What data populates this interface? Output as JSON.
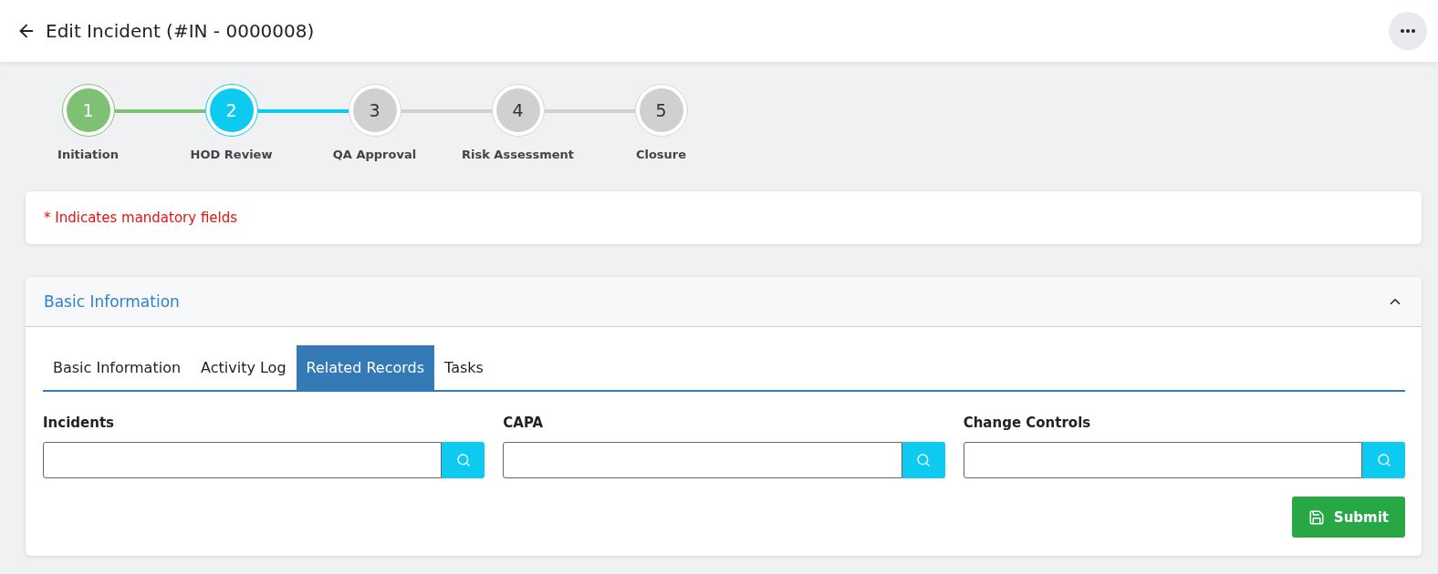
{
  "header": {
    "title": "Edit Incident (#IN - 0000008)"
  },
  "steps": [
    {
      "number": "1",
      "label": "Initiation",
      "completed": true,
      "selected": false
    },
    {
      "number": "2",
      "label": "HOD Review",
      "completed": false,
      "selected": true
    },
    {
      "number": "3",
      "label": "QA Approval",
      "completed": false,
      "selected": false
    },
    {
      "number": "4",
      "label": "Risk Assessment",
      "completed": false,
      "selected": false
    },
    {
      "number": "5",
      "label": "Closure",
      "completed": false,
      "selected": false
    }
  ],
  "notice": "* Indicates mandatory fields",
  "section": {
    "title": "Basic Information",
    "expanded": true,
    "tabs": [
      {
        "label": "Basic Information",
        "selected": false
      },
      {
        "label": "Activity Log",
        "selected": false
      },
      {
        "label": "Related Records",
        "selected": true
      },
      {
        "label": "Tasks",
        "selected": false
      }
    ],
    "fields": [
      {
        "label": "Incidents"
      },
      {
        "label": "CAPA"
      },
      {
        "label": "Change Controls"
      }
    ],
    "submit": "Submit"
  }
}
